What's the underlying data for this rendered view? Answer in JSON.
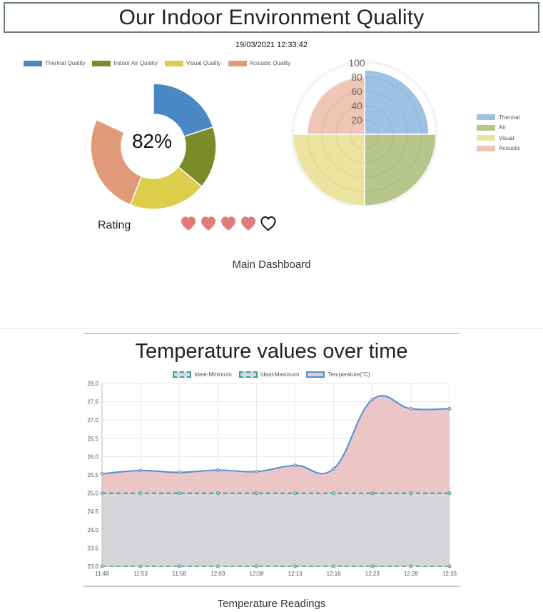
{
  "header": {
    "title": "Our Indoor Environment Quality",
    "datetime": "19/03/2021 12:33:42"
  },
  "donut": {
    "center_text": "82%",
    "legend": [
      {
        "label": "Thermal Quality",
        "color": "#4a87c5"
      },
      {
        "label": "Indoor Air Quality",
        "color": "#7a8c2a"
      },
      {
        "label": "Visual Quality",
        "color": "#dccd4a"
      },
      {
        "label": "Acoustic Quality",
        "color": "#e09a7a"
      }
    ]
  },
  "rating": {
    "label": "Rating",
    "filled": 4,
    "total": 5,
    "heart_color": "#e07b7b"
  },
  "polar": {
    "legend": [
      {
        "label": "Thermal",
        "color": "#9ec0e3"
      },
      {
        "label": "Air",
        "color": "#b7c48a"
      },
      {
        "label": "Visual",
        "color": "#ece39e"
      },
      {
        "label": "Acoustic",
        "color": "#efc5b5"
      }
    ]
  },
  "captions": {
    "main": "Main Dashboard",
    "temperature": "Temperature Readings"
  },
  "temperature_chart": {
    "title": "Temperature values over time",
    "legend": [
      "Ideal-Minimum",
      "Ideal-Maximum",
      "Temperature(°C)"
    ]
  },
  "chart_data": [
    {
      "type": "pie",
      "categories": [
        "Thermal Quality",
        "Indoor Air Quality",
        "Visual Quality",
        "Acoustic Quality"
      ],
      "values": [
        20,
        16,
        20,
        26
      ],
      "total_max": 100
    },
    {
      "type": "pie",
      "subtype": "polarArea",
      "categories": [
        "Thermal",
        "Air",
        "Visual",
        "Acoustic"
      ],
      "values": [
        90,
        100,
        100,
        80
      ],
      "ylim": [
        0,
        100
      ],
      "ticks": [
        "20",
        "40",
        "60",
        "80",
        "100"
      ]
    },
    {
      "type": "line",
      "title": "Temperature values over time",
      "x": [
        "11:48",
        "11:53",
        "11:58",
        "12:03",
        "12:08",
        "12:13",
        "12:18",
        "12:23",
        "12:28",
        "12:33"
      ],
      "ylim": [
        23.0,
        28.0
      ],
      "yticks": [
        "28.0",
        "27.5",
        "27.0",
        "26.5",
        "26.0",
        "25.5",
        "25.0",
        "24.5",
        "24.0",
        "23.5",
        "23.0"
      ],
      "series": [
        {
          "name": "Ideal-Minimum",
          "values": [
            23.0,
            23.0,
            23.0,
            23.0,
            23.0,
            23.0,
            23.0,
            23.0,
            23.0,
            23.0
          ]
        },
        {
          "name": "Ideal-Maximum",
          "values": [
            25.0,
            25.0,
            25.0,
            25.0,
            25.0,
            25.0,
            25.0,
            25.0,
            25.0,
            25.0
          ]
        },
        {
          "name": "Temperature(°C)",
          "values": [
            25.53,
            25.62,
            25.57,
            25.63,
            25.59,
            25.76,
            25.67,
            27.56,
            27.31,
            27.31
          ]
        }
      ],
      "grid": true,
      "legend": "top"
    }
  ]
}
